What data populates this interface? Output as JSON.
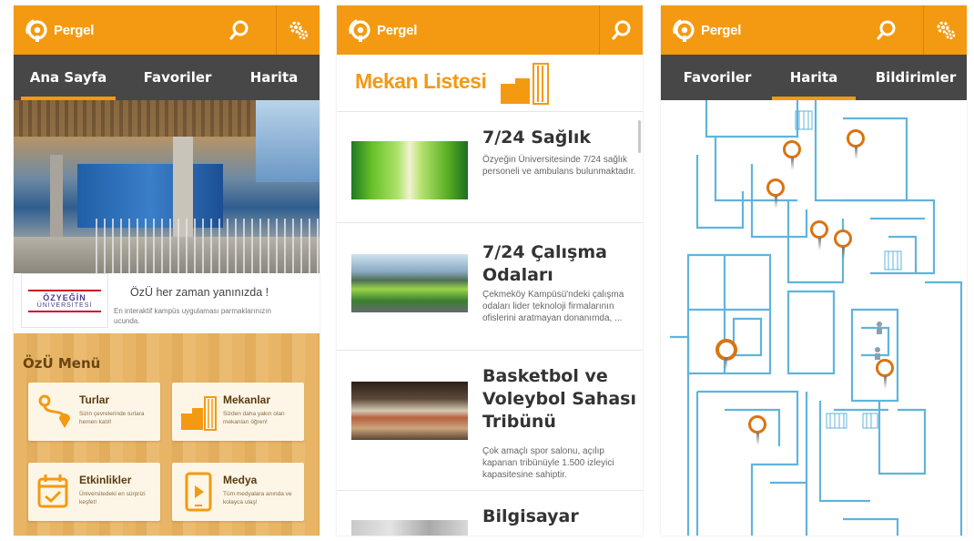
{
  "app": {
    "name": "Pergel"
  },
  "colors": {
    "accent": "#f39a12",
    "nav": "#474747",
    "map_lines": "#5fb4dd",
    "pin": "#d97410"
  },
  "screen1": {
    "tabs": [
      {
        "label": "Ana Sayfa",
        "active": true
      },
      {
        "label": "Favoriler",
        "active": false
      },
      {
        "label": "Harita",
        "active": false
      }
    ],
    "university_logo": {
      "line1": "ÖZYEĞİN",
      "line2": "ÜNİVERSİTESİ"
    },
    "tagline": "ÖzÜ her zaman yanınızda !",
    "subtagline": "En interaktif kampüs uygulaması parmaklarınızın ucunda.",
    "menu_title": "ÖzÜ Menü",
    "menu": [
      {
        "title": "Turlar",
        "desc": "Sizin çevrelerinde turlara hemen katıl!",
        "icon": "route-icon"
      },
      {
        "title": "Mekanlar",
        "desc": "Sizden daha yakın olan mekanları öğren!",
        "icon": "buildings-icon"
      },
      {
        "title": "Etkinlikler",
        "desc": "Üniversitedeki en sürprizi keşfet!",
        "icon": "calendar-icon"
      },
      {
        "title": "Medya",
        "desc": "Tüm medyalara anında ve kolayca ulaş!",
        "icon": "media-play-icon"
      }
    ]
  },
  "screen2": {
    "list_title": "Mekan Listesi",
    "items": [
      {
        "title": "7/24 Sağlık",
        "desc": "Özyeğin Üniversitesinde 7/24 sağlık personeli ve ambulans bulunmaktadır."
      },
      {
        "title": "7/24 Çalışma Odaları",
        "desc": "Çekmeköy Kampüsü'ndeki çalışma odaları lider teknoloji firmalarının ofislerini aratmayan donanımda, ..."
      },
      {
        "title": "Basketbol ve Voleybol Sahası Tribünü",
        "desc": "Çok amaçlı spor salonu, açılıp kapanan tribünüyle 1.500 izleyici kapasitesine sahiptir."
      },
      {
        "title": "Bilgisayar",
        "desc": ""
      }
    ]
  },
  "screen3": {
    "tabs": [
      {
        "label": "Favoriler",
        "active": false
      },
      {
        "label": "Harita",
        "active": true
      },
      {
        "label": "Bildirimler",
        "active": false
      }
    ]
  }
}
